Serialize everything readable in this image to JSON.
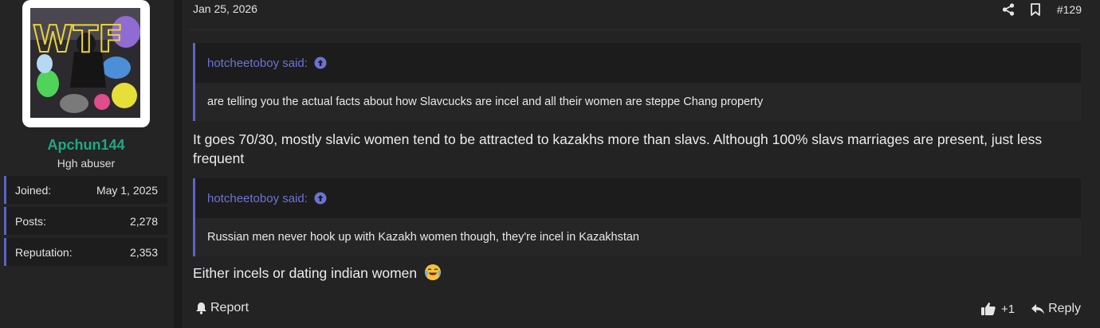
{
  "user": {
    "name": "Apchun144",
    "title": "Hgh abuser",
    "avatar_overlay_text": "WTF",
    "stats": [
      {
        "label": "Joined:",
        "value": "May 1, 2025"
      },
      {
        "label": "Posts:",
        "value": "2,278"
      },
      {
        "label": "Reputation:",
        "value": "2,353"
      }
    ]
  },
  "post": {
    "date": "Jan 25, 2026",
    "number": "#129",
    "quotes": [
      {
        "author": "hotcheetoboy said:",
        "text": "are telling you the actual facts about how Slavcucks are incel and all their women are steppe Chang property"
      },
      {
        "author": "hotcheetoboy said:",
        "text": "Russian men never hook up with Kazakh women though, they're incel in Kazakhstan"
      }
    ],
    "messages": [
      "It goes 70/30, mostly slavic women tend to be attracted to kazakhs more than slavs. Although 100% slavs marriages are present, just less frequent",
      "Either incels or dating indian women"
    ],
    "actions": {
      "report": "Report",
      "like_count": "+1",
      "reply": "Reply"
    }
  },
  "colors": {
    "accent": "#5b64c6",
    "quote_author": "#6a74d6",
    "username": "#1fa884",
    "post_bg": "#232323"
  },
  "icons": [
    "share-icon",
    "bookmark-icon",
    "arrow-up-circle-icon",
    "bell-icon",
    "thumbs-up-icon",
    "reply-icon",
    "laughing-crying-emoji-icon"
  ]
}
